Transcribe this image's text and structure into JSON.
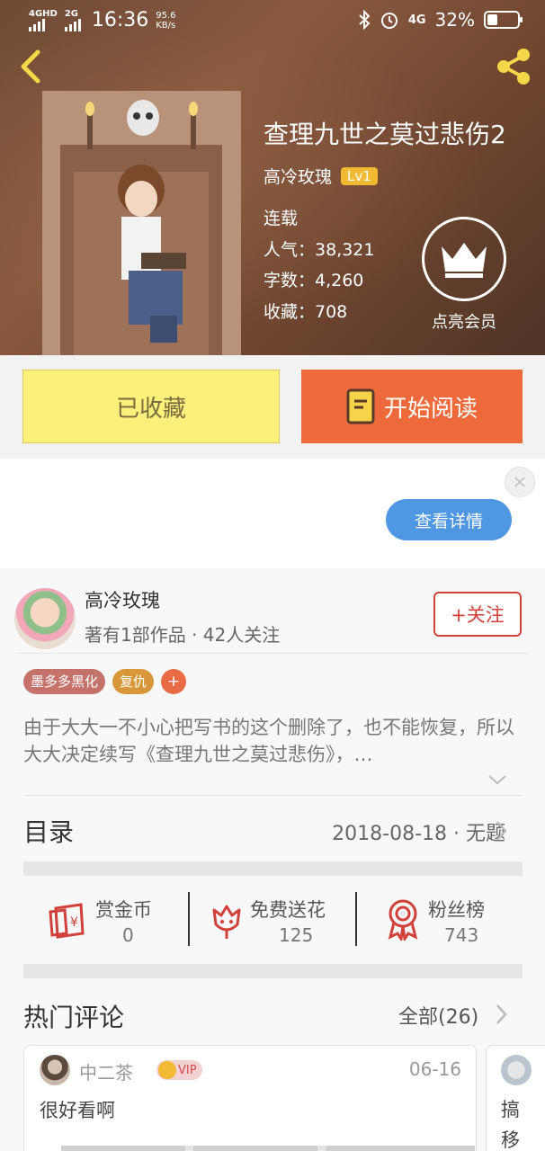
{
  "status_bar": {
    "net1": "4GHD",
    "net2": "2G",
    "time": "16:36",
    "speed_value": "95.6",
    "speed_unit": "KB/s",
    "net3": "4G",
    "battery": "32%"
  },
  "book": {
    "title": "查理九世之莫过悲伤2",
    "author": "高冷玫瑰",
    "level": "Lv1",
    "status": "连载",
    "popularity": "人气：38,321",
    "word_count": "字数：4,260",
    "favorites": "收藏：708",
    "vip_label": "点亮会员"
  },
  "actions": {
    "favorited": "已收藏",
    "start_reading": "开始阅读"
  },
  "ad": {
    "details_button": "查看详情"
  },
  "author_profile": {
    "name": "高冷玫瑰",
    "stats": "著有1部作品 · 42人关注",
    "follow": "+关注"
  },
  "tags": [
    {
      "label": "墨多多黑化",
      "color": "#c5736a"
    },
    {
      "label": "复仇",
      "color": "#d8973a"
    }
  ],
  "tag_add": "+",
  "synopsis": "由于大大一不小心把写书的这个删除了，也不能恢复，所以大大决定续写《查理九世之莫过悲伤》，…",
  "toc": {
    "title": "目录",
    "latest": "2018-08-18 · 无题"
  },
  "stats": [
    {
      "label": "赏金币",
      "value": "0",
      "icon": "red-envelope-icon"
    },
    {
      "label": "免费送花",
      "value": "125",
      "icon": "flower-icon"
    },
    {
      "label": "粉丝榜",
      "value": "743",
      "icon": "award-medal-icon"
    }
  ],
  "hot_comments": {
    "title": "热门评论",
    "all": "全部(26)",
    "items": [
      {
        "user": "中二茶",
        "badge": "VIP",
        "date": "06-16",
        "text": "很好看啊"
      },
      {
        "text": "搞移"
      }
    ]
  },
  "colors": {
    "accent_orange": "#ef6a3a",
    "fav_yellow": "#fbf17a",
    "follow_red": "#d2403a",
    "ad_blue": "#4f97e3"
  }
}
